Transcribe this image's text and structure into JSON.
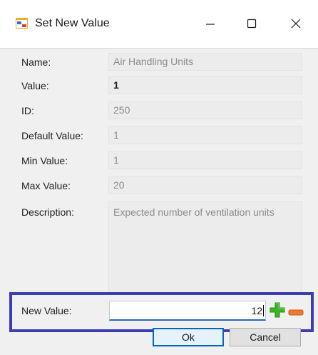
{
  "window": {
    "title": "Set New Value",
    "minimize_label": "—",
    "maximize_label": "☐",
    "close_label": "✕"
  },
  "fields": [
    {
      "label": "Name:",
      "value": "Air Handling Units"
    },
    {
      "label": "Value:",
      "value": "1"
    },
    {
      "label": "ID:",
      "value": "250"
    },
    {
      "label": "Default Value:",
      "value": "1"
    },
    {
      "label": "Min Value:",
      "value": "1"
    },
    {
      "label": "Max Value:",
      "value": "20"
    },
    {
      "label": "Description:",
      "value": "Expected number of ventilation units"
    }
  ],
  "new_value": {
    "label": "New Value:",
    "value": "12"
  },
  "buttons": {
    "ok": "Ok",
    "cancel": "Cancel"
  },
  "colors": {
    "highlight_border": "#3d3eb5",
    "plus_icon": "#3cb521",
    "minus_icon": "#f07a2a",
    "focus_accent": "#0067c0"
  }
}
